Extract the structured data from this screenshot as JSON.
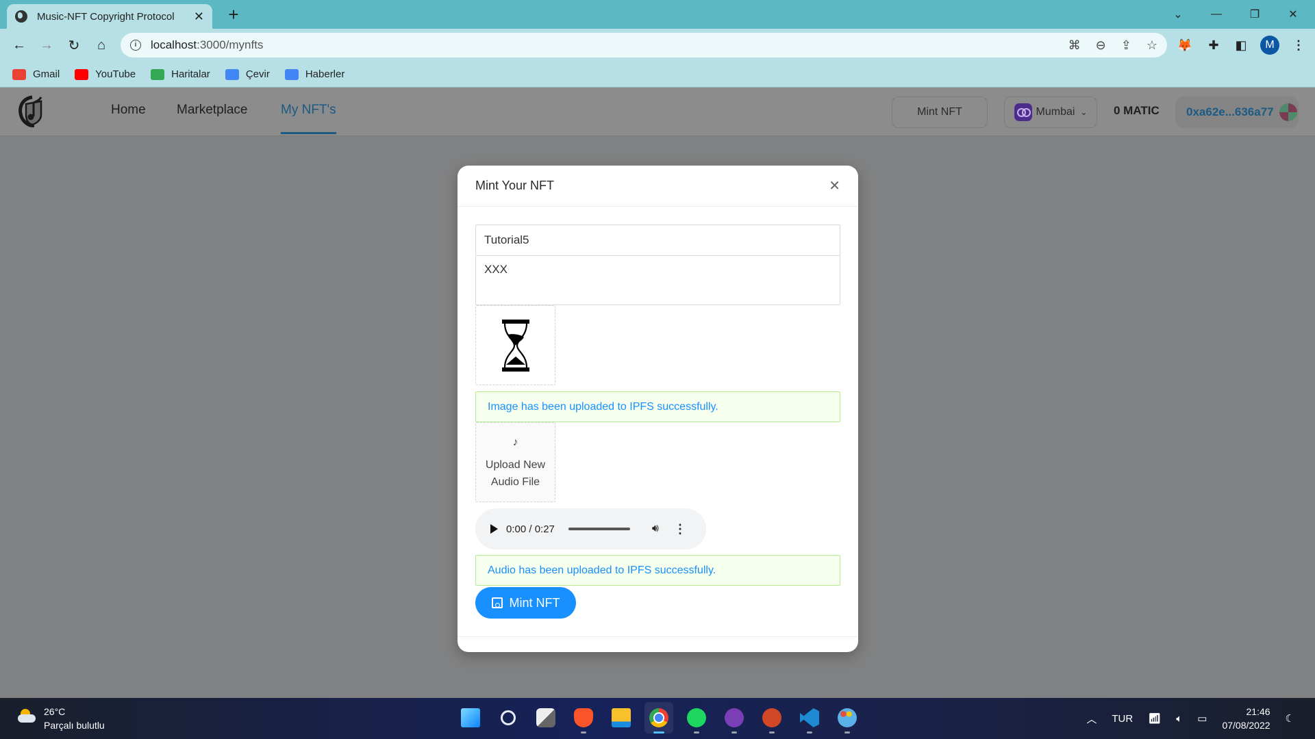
{
  "browser": {
    "tab_title": "Music-NFT Copyright Protocol",
    "url_host": "localhost",
    "url_rest": ":3000/mynfts",
    "profile_initial": "M",
    "bookmarks": [
      {
        "label": "Gmail",
        "icon": "gmail-icon",
        "color": "#ea4335"
      },
      {
        "label": "YouTube",
        "icon": "youtube-icon",
        "color": "#ff0000"
      },
      {
        "label": "Haritalar",
        "icon": "maps-icon",
        "color": "#34a853"
      },
      {
        "label": "Çevir",
        "icon": "translate-icon",
        "color": "#4285f4"
      },
      {
        "label": "Haberler",
        "icon": "news-icon",
        "color": "#4285f4"
      }
    ]
  },
  "app": {
    "nav": [
      {
        "label": "Home"
      },
      {
        "label": "Marketplace"
      },
      {
        "label": "My NFT's",
        "active": true
      }
    ],
    "mint_button": "Mint NFT",
    "network": "Mumbai",
    "balance": "0 MATIC",
    "address": "0xa62e...636a77"
  },
  "modal": {
    "title": "Mint Your NFT",
    "name_value": "Tutorial5",
    "description_value": "XXX",
    "image_alert": "Image has been uploaded to IPFS successfully.",
    "audio_upload_label": "Upload New Audio File",
    "audio_time": "0:00 / 0:27",
    "audio_alert": "Audio has been uploaded to IPFS successfully.",
    "mint_button": "Mint NFT"
  },
  "taskbar": {
    "temperature": "26°C",
    "weather": "Parçalı bulutlu",
    "language": "TUR",
    "time": "21:46",
    "date": "07/08/2022",
    "apps": [
      {
        "name": "start",
        "color": "#4cc2ff"
      },
      {
        "name": "search",
        "color": "#c9d3e6"
      },
      {
        "name": "task-view",
        "color": "#9a9a9a"
      },
      {
        "name": "brave",
        "color": "#fb542b"
      },
      {
        "name": "file-explorer",
        "color": "#f8c12c"
      },
      {
        "name": "chrome",
        "color": "#4285f4",
        "active": true
      },
      {
        "name": "spotify",
        "color": "#1ed760"
      },
      {
        "name": "github-desktop",
        "color": "#7b3fb5"
      },
      {
        "name": "powerpoint",
        "color": "#d24726"
      },
      {
        "name": "vscode",
        "color": "#1f8ad2"
      },
      {
        "name": "paint",
        "color": "#5ab0e8"
      }
    ]
  }
}
